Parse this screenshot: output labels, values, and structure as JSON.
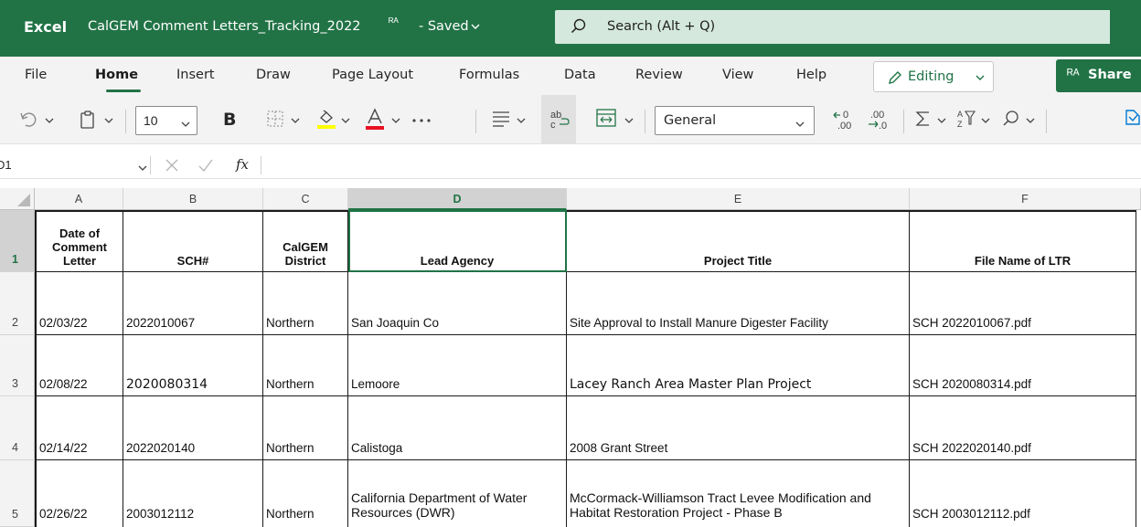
{
  "titlebar": {
    "app_name": "Excel",
    "document_name": "CalGEM Comment Letters_Tracking_2022",
    "share_indicator": "ᴿᴬ",
    "status": "- Saved",
    "search_placeholder": "Search (Alt + Q)",
    "brand_color": "#217346"
  },
  "menu": {
    "tabs": [
      "File",
      "Home",
      "Insert",
      "Draw",
      "Page Layout",
      "Formulas",
      "Data",
      "Review",
      "View",
      "Help"
    ],
    "active_tab": "Home",
    "editing_label": "Editing",
    "share_label": "Share"
  },
  "toolbar": {
    "font_size": "10",
    "bold_label": "B",
    "number_format": "General",
    "icons": [
      "undo-icon",
      "clipboard-icon",
      "borders-icon",
      "fill-color-icon",
      "font-color-icon",
      "more-icon",
      "align-icon",
      "wrap-text-icon",
      "merge-icon",
      "increase-decimal-icon",
      "decrease-decimal-icon",
      "autosum-icon",
      "sort-filter-icon",
      "find-icon"
    ]
  },
  "formula_bar": {
    "name_box": "D1",
    "fx_label": "fx",
    "value": ""
  },
  "sheet": {
    "selected_cell": "D1",
    "columns": [
      "A",
      "B",
      "C",
      "D",
      "E",
      "F"
    ],
    "row_numbers": [
      "1",
      "2",
      "3",
      "4",
      "5"
    ],
    "header_row": [
      "Date of Comment Letter",
      "SCH#",
      "CalGEM District",
      "Lead Agency",
      "Project Title",
      "File Name of LTR"
    ],
    "rows": [
      [
        "02/03/22",
        "2022010067",
        "Northern",
        "San Joaquin Co",
        "Site Approval to Install Manure Digester Facility",
        "SCH 2022010067.pdf"
      ],
      [
        "02/08/22",
        "2020080314",
        "Northern",
        "Lemoore",
        "Lacey Ranch Area Master Plan Project",
        "SCH 2020080314.pdf"
      ],
      [
        "02/14/22",
        "2022020140",
        "Northern",
        "Calistoga",
        "2008 Grant Street",
        "SCH 2022020140.pdf"
      ],
      [
        "02/26/22",
        "2003012112",
        "Northern",
        "California Department of Water Resources (DWR)",
        "McCormack-Williamson Tract Levee Modification and Habitat Restoration Project - Phase B",
        "SCH 2003012112.pdf"
      ]
    ]
  }
}
